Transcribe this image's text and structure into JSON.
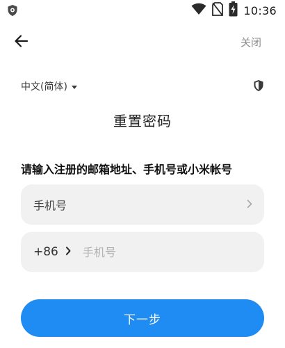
{
  "status_bar": {
    "time": "10:36",
    "icons": [
      "app-shield-icon",
      "wifi-icon",
      "no-sim-icon",
      "battery-charging-icon"
    ]
  },
  "header": {
    "back_icon": "arrow-left-icon",
    "close_label": "关闭"
  },
  "language": {
    "selected": "中文(简体)"
  },
  "security_icon": "shield-icon",
  "page_title": "重置密码",
  "instruction": "请输入注册的邮箱地址、手机号或小米帐号",
  "account_type": {
    "label": "手机号",
    "icon": "chevron-right-icon"
  },
  "phone": {
    "country_code": "+86",
    "placeholder": "手机号",
    "value": ""
  },
  "next_button_label": "下一步",
  "colors": {
    "primary": "#1e8cf2",
    "field_bg": "#f1f1f1",
    "muted_text": "#8c8c8c"
  }
}
